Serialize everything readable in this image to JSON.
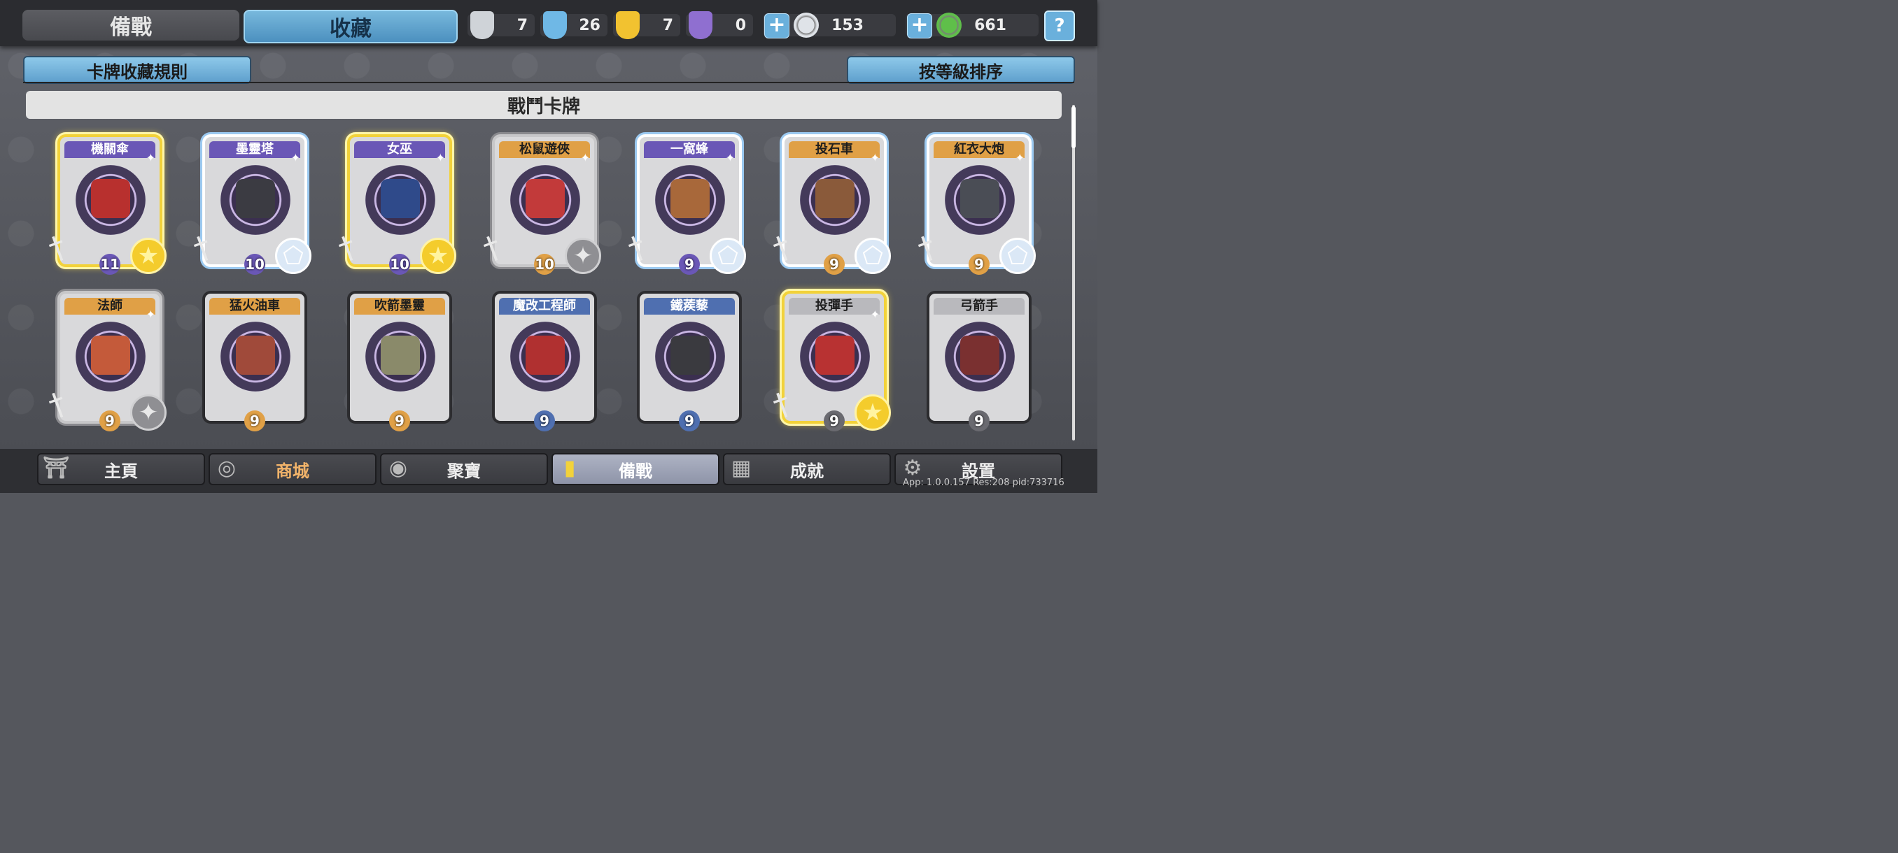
{
  "top_tabs": {
    "prep": "備戰",
    "collection": "收藏"
  },
  "resources": [
    {
      "icon": "silver-crest-icon",
      "value": "7",
      "color": "#cfd3d8"
    },
    {
      "icon": "blue-crest-icon",
      "value": "26",
      "color": "#6fb8e6"
    },
    {
      "icon": "gold-crest-icon",
      "value": "7",
      "color": "#f2c230"
    },
    {
      "icon": "purple-crest-icon",
      "value": "0",
      "color": "#8f6fd0"
    }
  ],
  "currencies": [
    {
      "icon": "silver-coin-icon",
      "plus": "+",
      "value": "153",
      "color": "#dfe3e8"
    },
    {
      "icon": "green-gem-icon",
      "plus": "+",
      "value": "661",
      "color": "#5fbf4a"
    }
  ],
  "help_label": "?",
  "sub_header": {
    "rules": "卡牌收藏規則",
    "sort": "按等級排序"
  },
  "section_title": "戰鬥卡牌",
  "cards": [
    {
      "name": "機關傘",
      "level": "11",
      "tier": "gold",
      "name_color": "purple",
      "face": "#b8302e",
      "lvl_bg": "#6a57b6"
    },
    {
      "name": "墨靈塔",
      "level": "10",
      "tier": "blue",
      "name_color": "purple",
      "face": "#3b3b42",
      "lvl_bg": "#6a57b6"
    },
    {
      "name": "女巫",
      "level": "10",
      "tier": "gold",
      "name_color": "purple",
      "face": "#2f4a8a",
      "lvl_bg": "#6a57b6"
    },
    {
      "name": "松鼠遊俠",
      "level": "10",
      "tier": "silver",
      "name_color": "orange",
      "face": "#c23a3a",
      "lvl_bg": "#e0a046"
    },
    {
      "name": "一窩蜂",
      "level": "9",
      "tier": "blue",
      "name_color": "purple",
      "face": "#a8683a",
      "lvl_bg": "#6a57b6"
    },
    {
      "name": "投石車",
      "level": "9",
      "tier": "blue",
      "name_color": "orange",
      "face": "#8a5a3a",
      "lvl_bg": "#e0a046"
    },
    {
      "name": "紅衣大炮",
      "level": "9",
      "tier": "blue",
      "name_color": "orange",
      "face": "#4a4d55",
      "lvl_bg": "#e0a046"
    },
    {
      "name": "法師",
      "level": "9",
      "tier": "silver",
      "name_color": "orange",
      "face": "#c45a3a",
      "lvl_bg": "#e0a046"
    },
    {
      "name": "猛火油車",
      "level": "9",
      "tier": "none",
      "name_color": "orange",
      "face": "#a04a3a",
      "lvl_bg": "#e0a046"
    },
    {
      "name": "吹箭墨靈",
      "level": "9",
      "tier": "none",
      "name_color": "orange",
      "face": "#8a8a6a",
      "lvl_bg": "#e0a046"
    },
    {
      "name": "魔改工程師",
      "level": "9",
      "tier": "none",
      "name_color": "blue",
      "face": "#b03030",
      "lvl_bg": "#4f6fb0"
    },
    {
      "name": "鐵蒺藜",
      "level": "9",
      "tier": "none",
      "name_color": "blue",
      "face": "#3a3a3f",
      "lvl_bg": "#4f6fb0"
    },
    {
      "name": "投彈手",
      "level": "9",
      "tier": "gold",
      "name_color": "silver",
      "face": "#b83232",
      "lvl_bg": "#6a6a70"
    },
    {
      "name": "弓箭手",
      "level": "9",
      "tier": "none",
      "name_color": "silver",
      "face": "#7a3030",
      "lvl_bg": "#6a6a70"
    }
  ],
  "bottom_nav": [
    {
      "label": "主頁",
      "icon": "pagoda-icon",
      "state": "normal"
    },
    {
      "label": "商城",
      "icon": "coins-icon",
      "state": "shop"
    },
    {
      "label": "聚寶",
      "icon": "treasure-bowl-icon",
      "state": "normal"
    },
    {
      "label": "備戰",
      "icon": "card-deck-icon",
      "state": "active"
    },
    {
      "label": "成就",
      "icon": "achievement-grid-icon",
      "state": "normal"
    },
    {
      "label": "設置",
      "icon": "gear-icon",
      "state": "normal"
    }
  ],
  "version_text": "App: 1.0.0.157 Res:208 pid:733716"
}
